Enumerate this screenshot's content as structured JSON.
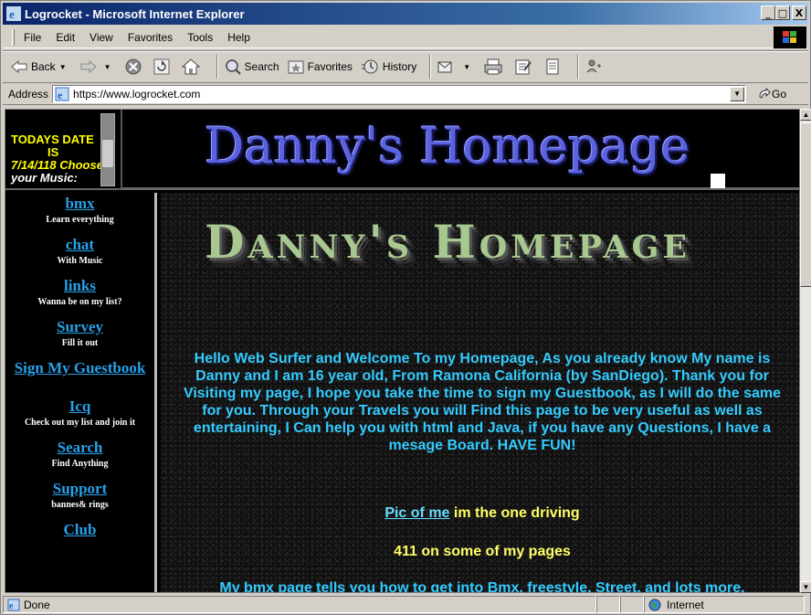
{
  "window": {
    "title": "Logrocket - Microsoft Internet Explorer",
    "buttons": {
      "minimize": "_",
      "maximize": "□",
      "close": "X"
    }
  },
  "menubar": {
    "items": [
      {
        "label": "File"
      },
      {
        "label": "Edit"
      },
      {
        "label": "View"
      },
      {
        "label": "Favorites"
      },
      {
        "label": "Tools"
      },
      {
        "label": "Help"
      }
    ]
  },
  "toolbar": {
    "back_label": "Back",
    "search_label": "Search",
    "favorites_label": "Favorites",
    "history_label": "History"
  },
  "addressbar": {
    "label": "Address",
    "url": "https://www.logrocket.com",
    "go_label": "Go"
  },
  "page": {
    "date_box": {
      "line1": "TODAYS DATE",
      "line2": "IS",
      "line3": "7/14/118 Choose",
      "line4": "your Music:"
    },
    "logo_title": "Danny's Homepage",
    "banner_title": "Danny's Homepage",
    "nav": [
      {
        "link": "bmx",
        "sub": "Learn everything"
      },
      {
        "link": "chat",
        "sub": "With Music"
      },
      {
        "link": "links",
        "sub": "Wanna be on my list?"
      },
      {
        "link": "Survey",
        "sub": "Fill it out"
      },
      {
        "link": "Sign My Guestbook",
        "sub": ""
      },
      {
        "link": "Icq",
        "sub": "Check out my list and join it"
      },
      {
        "link": "Search",
        "sub": "Find Anything"
      },
      {
        "link": "Support",
        "sub": "bannes& rings"
      },
      {
        "link": "Club",
        "sub": ""
      }
    ],
    "welcome_text": "Hello Web Surfer and Welcome To my Homepage, As you already know My name is Danny and I am 16 year old, From Ramona California (by SanDiego). Thank you for Visiting my page, I hope you take the time to sign my Guestbook, as I will do the same for you. Through your Travels you will Find this page to be very useful as well as entertaining, I Can help you with html and Java, if you have any Questions, I have a mesage Board. HAVE FUN!",
    "pic_link": "Pic of me",
    "pic_text": " im the one driving",
    "counter_text": "411 on some of my pages",
    "bmx_text": "My bmx page tells you how to get into Bmx, freestyle, Street, and lots more."
  },
  "statusbar": {
    "status": "Done",
    "zone": "Internet"
  }
}
